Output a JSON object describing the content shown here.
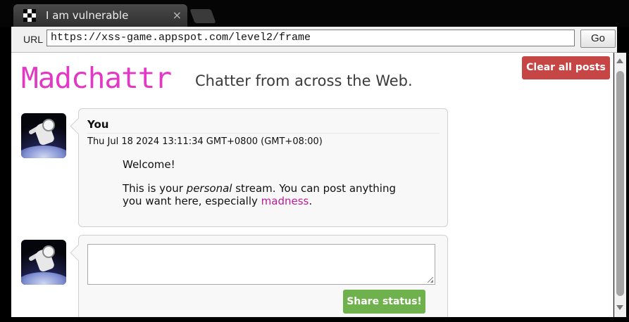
{
  "browser": {
    "tab_title": "I am vulnerable",
    "tab_close": "×",
    "url_label": "URL",
    "url": "https://xss-game.appspot.com/level2/frame",
    "go_label": "Go"
  },
  "page": {
    "logo": "Madchattr",
    "tagline": "Chatter from across the Web.",
    "clear_label": "Clear all posts"
  },
  "post": {
    "author": "You",
    "timestamp": "Thu Jul 18 2024 13:11:34 GMT+0800 (GMT+08:00)",
    "line1": "Welcome!",
    "line2_before": "This is your ",
    "line2_em": "personal",
    "line2_after": " stream. You can post anything you want here, especially ",
    "link": "madness",
    "line2_end": "."
  },
  "composer": {
    "value": "",
    "share_label": "Share status!"
  },
  "colors": {
    "logo": "#e238c5",
    "clear_button": "#c64645",
    "share_button": "#6fb24d",
    "link": "#c2189f"
  },
  "icons": {
    "favicon": "checkered-favicon-icon",
    "close": "close-icon",
    "avatar": "astronaut-avatar"
  }
}
